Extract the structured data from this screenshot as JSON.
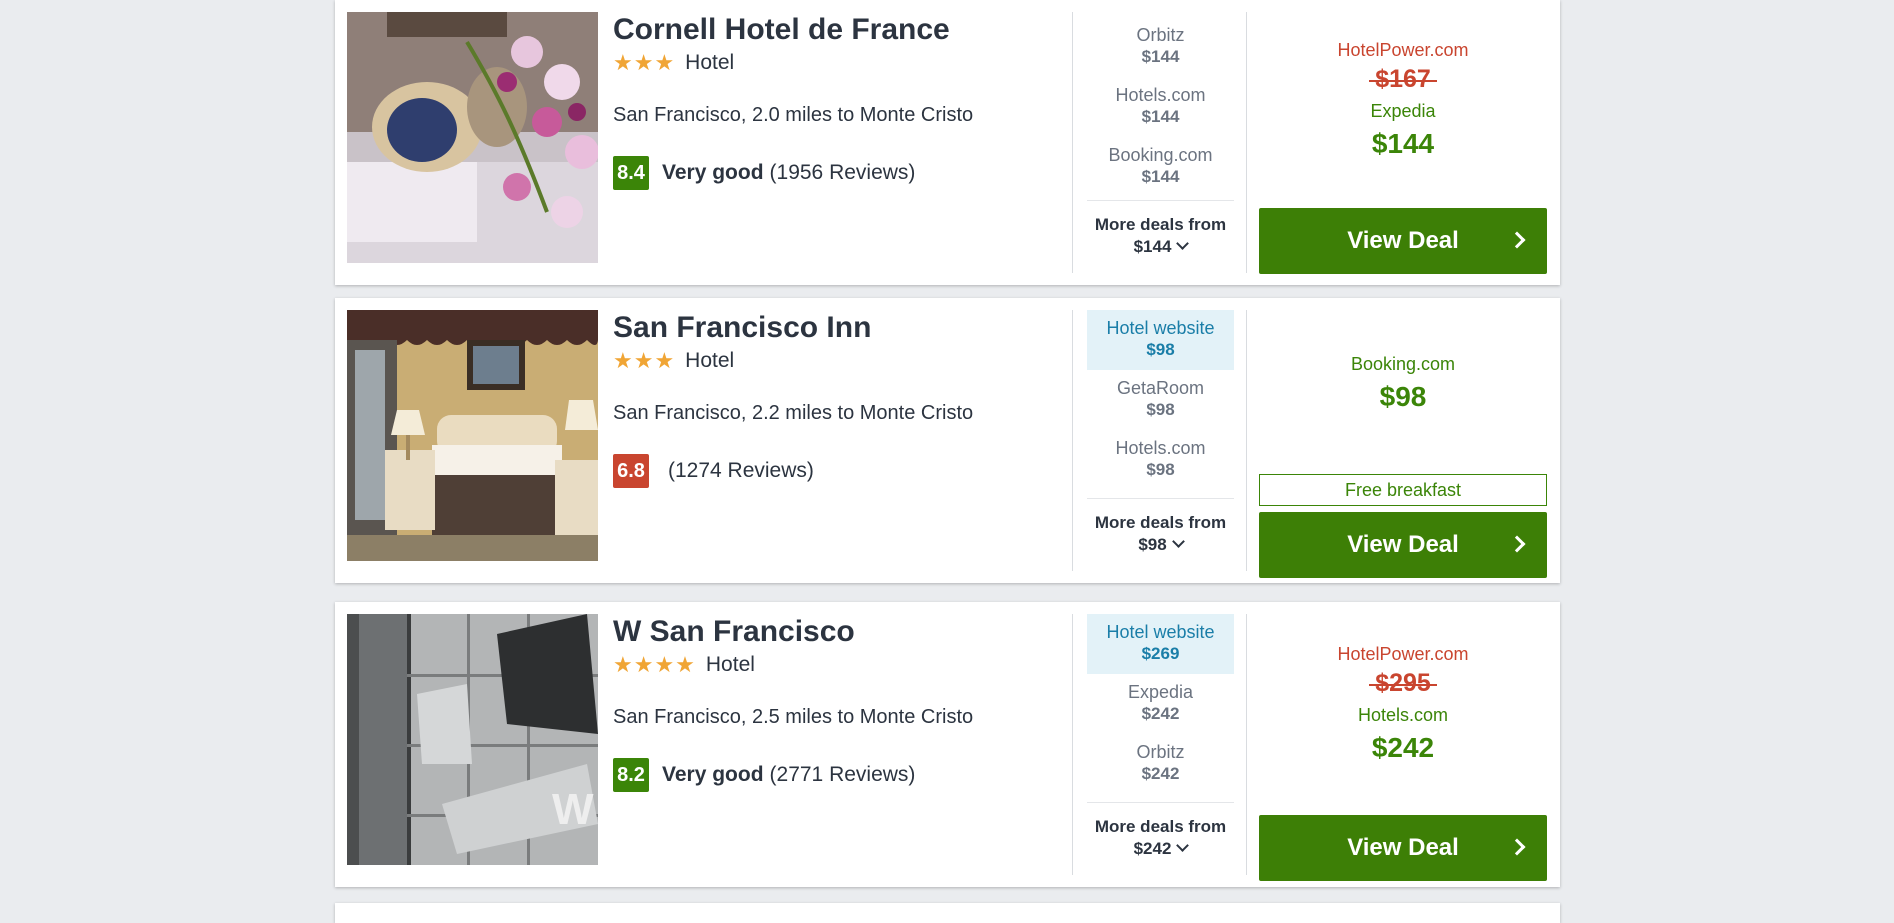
{
  "hotels": [
    {
      "name": "Cornell Hotel de France",
      "stars": "★★★",
      "type": "Hotel",
      "location": "San Francisco, 2.0 miles to Monte Cristo",
      "score": "8.4",
      "rating_label": "Very good",
      "reviews": "(1956 Reviews)",
      "deals": [
        {
          "provider": "Orbitz",
          "price": "$144"
        },
        {
          "provider": "Hotels.com",
          "price": "$144"
        },
        {
          "provider": "Booking.com",
          "price": "$144"
        }
      ],
      "more_label": "More deals from",
      "more_price": "$144",
      "offer_old_provider": "HotelPower.com",
      "offer_old_price": "$167",
      "offer_provider": "Expedia",
      "offer_price": "$144",
      "button": "View Deal"
    },
    {
      "name": "San Francisco Inn",
      "stars": "★★★",
      "type": "Hotel",
      "location": "San Francisco, 2.2 miles to Monte Cristo",
      "score": "6.8",
      "rating_label": "",
      "reviews": "(1274 Reviews)",
      "deals": [
        {
          "provider": "Hotel website",
          "price": "$98"
        },
        {
          "provider": "GetaRoom",
          "price": "$98"
        },
        {
          "provider": "Hotels.com",
          "price": "$98"
        }
      ],
      "more_label": "More deals from",
      "more_price": "$98",
      "offer_provider": "Booking.com",
      "offer_price": "$98",
      "freebie": "Free breakfast",
      "button": "View Deal"
    },
    {
      "name": "W San Francisco",
      "stars": "★★★★",
      "type": "Hotel",
      "location": "San Francisco, 2.5 miles to Monte Cristo",
      "score": "8.2",
      "rating_label": "Very good",
      "reviews": "(2771 Reviews)",
      "deals": [
        {
          "provider": "Hotel website",
          "price": "$269"
        },
        {
          "provider": "Expedia",
          "price": "$242"
        },
        {
          "provider": "Orbitz",
          "price": "$242"
        }
      ],
      "more_label": "More deals from",
      "more_price": "$242",
      "offer_old_provider": "HotelPower.com",
      "offer_old_price": "$295",
      "offer_provider": "Hotels.com",
      "offer_price": "$242",
      "button": "View Deal"
    }
  ],
  "colors": {
    "accent_green": "#3d7f06",
    "score_good": "#3b8508",
    "score_bad": "#c9452f",
    "strike_red": "#c9452f",
    "highlight_blue": "#1a7ea8",
    "star_orange": "#f0a535"
  }
}
